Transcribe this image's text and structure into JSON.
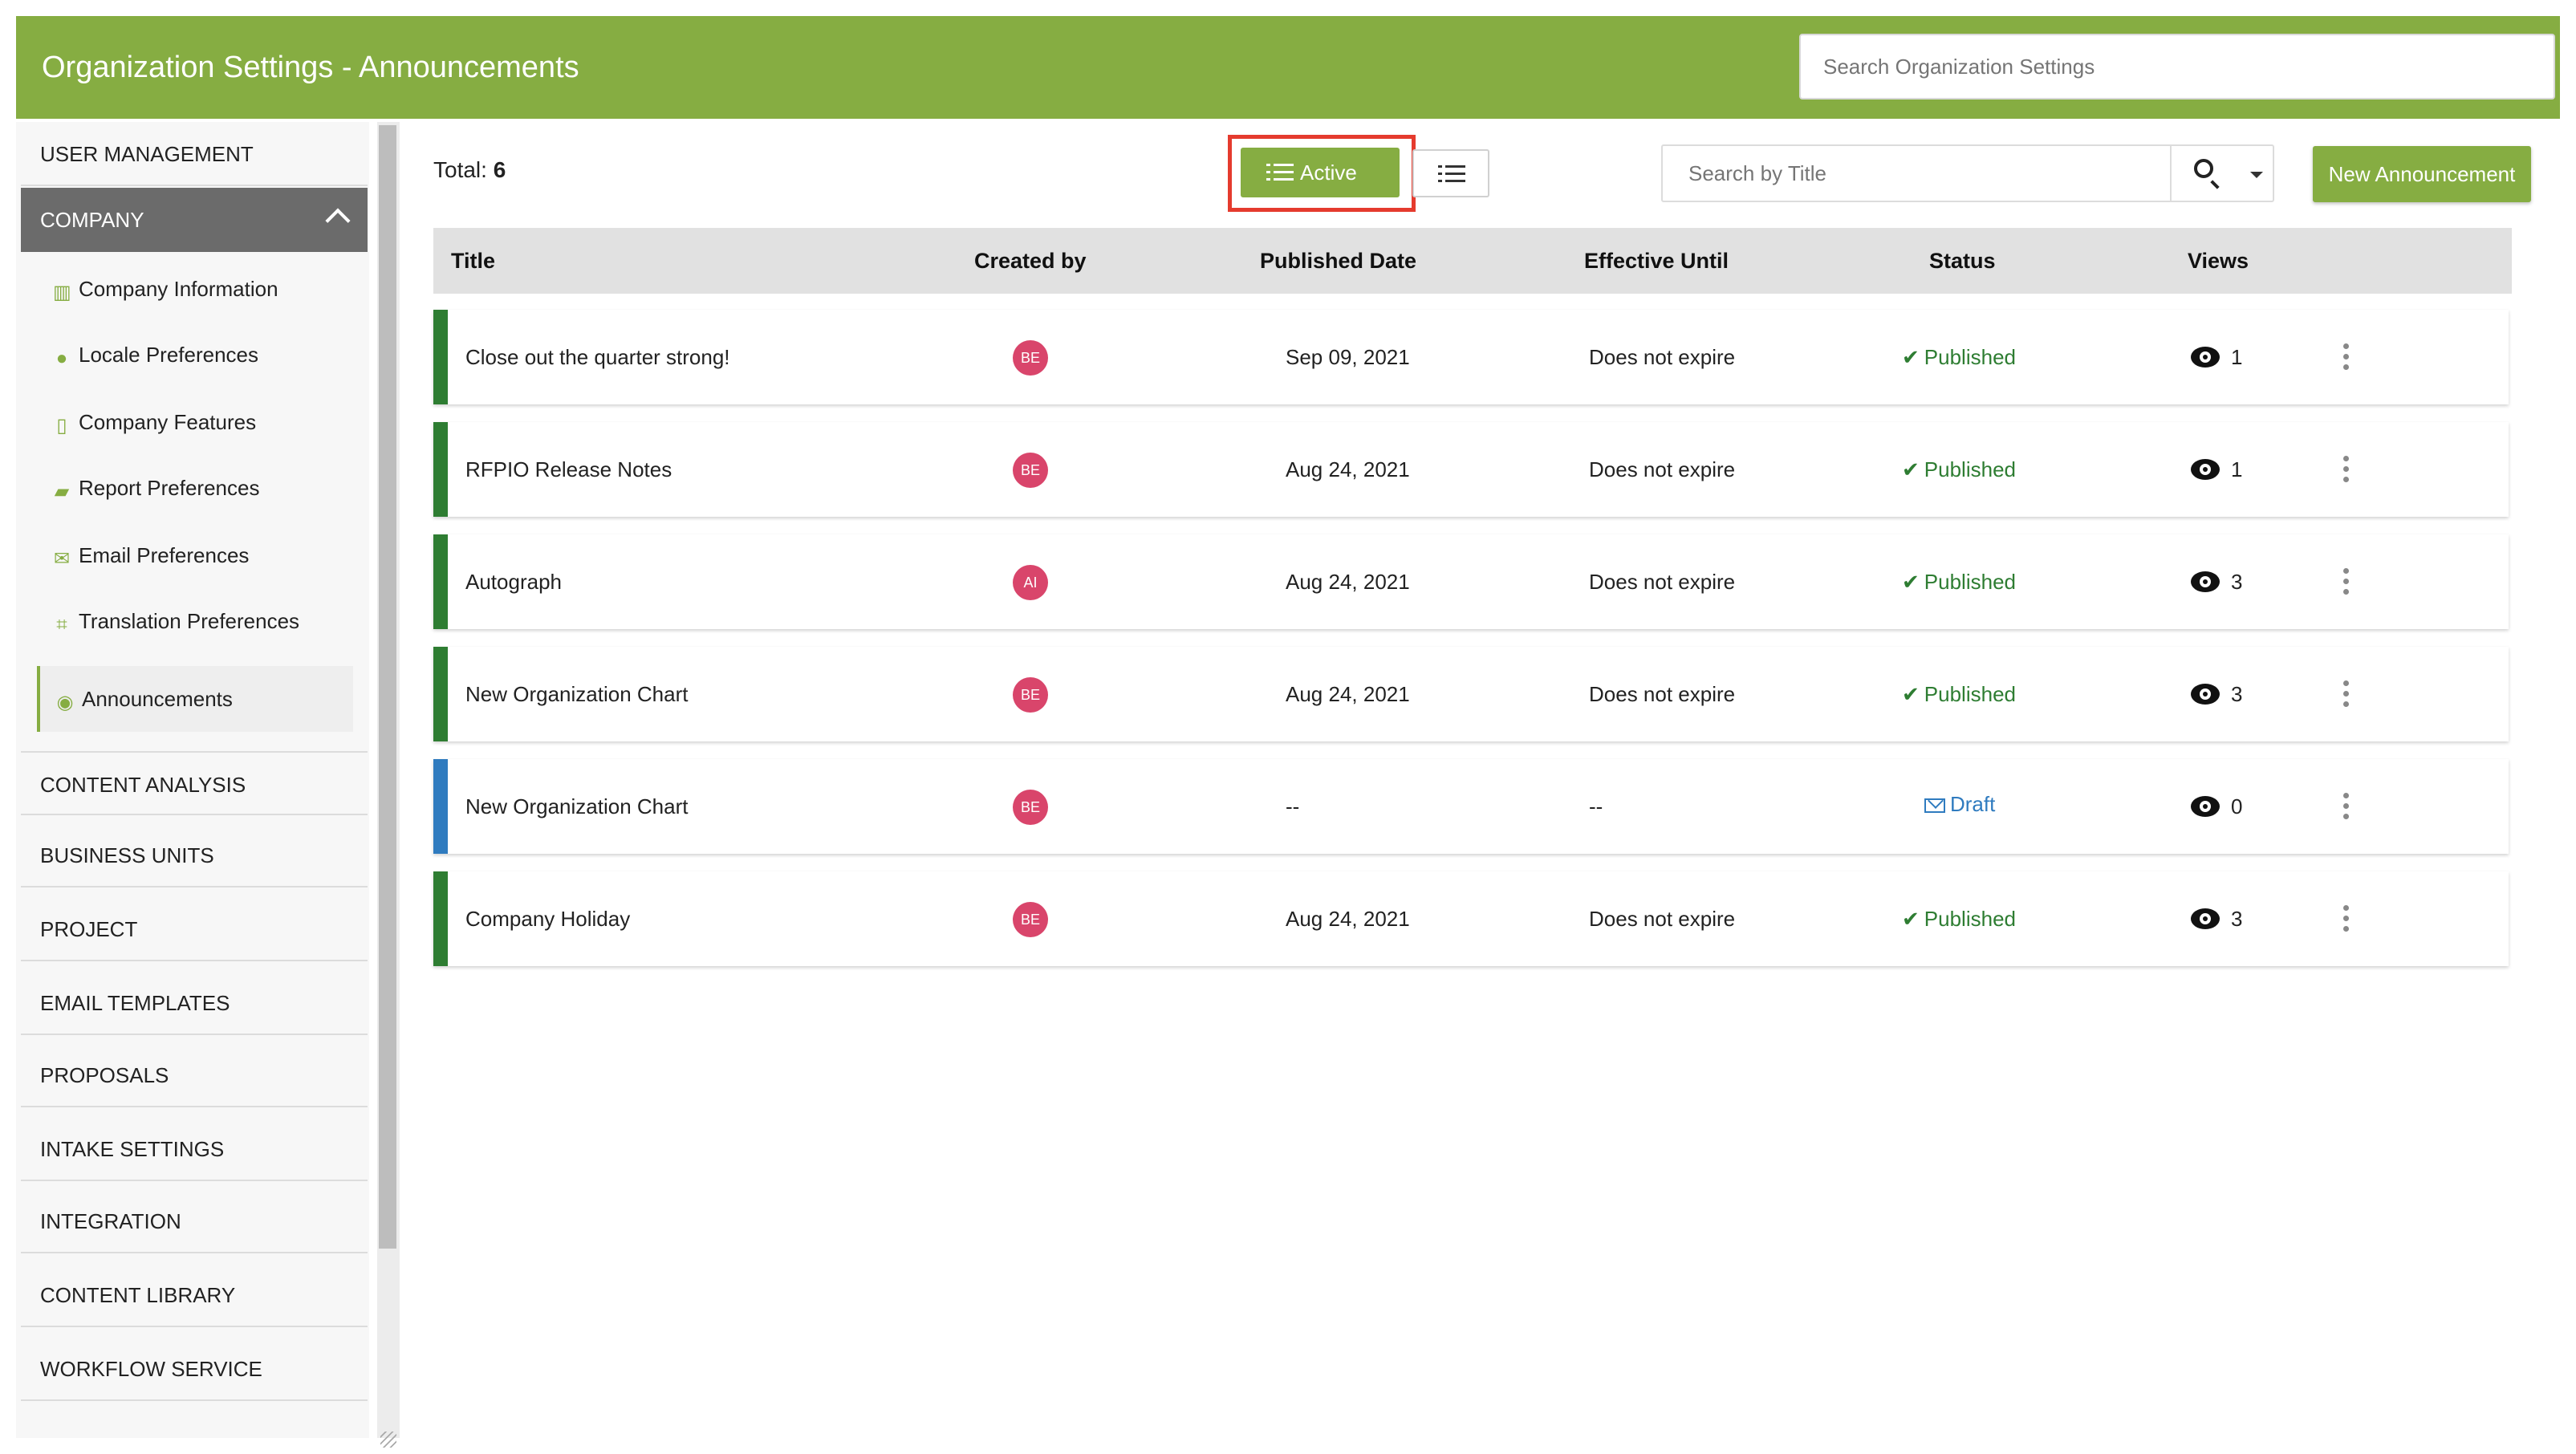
{
  "header": {
    "title": "Organization Settings - Announcements",
    "search_placeholder": "Search Organization Settings"
  },
  "sidebar": {
    "sections": [
      {
        "label": "USER MANAGEMENT"
      },
      {
        "label": "COMPANY",
        "expanded": true
      },
      {
        "label": "CONTENT ANALYSIS"
      },
      {
        "label": "BUSINESS UNITS"
      },
      {
        "label": "PROJECT"
      },
      {
        "label": "EMAIL TEMPLATES"
      },
      {
        "label": "PROPOSALS"
      },
      {
        "label": "INTAKE SETTINGS"
      },
      {
        "label": "INTEGRATION"
      },
      {
        "label": "CONTENT LIBRARY"
      },
      {
        "label": "WORKFLOW SERVICE"
      }
    ],
    "company_items": [
      {
        "label": "Company Information",
        "icon": "building-icon"
      },
      {
        "label": "Locale Preferences",
        "icon": "globe-icon"
      },
      {
        "label": "Company Features",
        "icon": "bookmark-icon"
      },
      {
        "label": "Report Preferences",
        "icon": "book-icon"
      },
      {
        "label": "Email Preferences",
        "icon": "envelope-icon"
      },
      {
        "label": "Translation Preferences",
        "icon": "translate-icon"
      },
      {
        "label": "Announcements",
        "icon": "broadcast-icon",
        "selected": true
      }
    ]
  },
  "toolbar": {
    "total_label": "Total:",
    "total_value": "6",
    "active_label": "Active",
    "title_search_placeholder": "Search by Title",
    "new_button_label": "New Announcement"
  },
  "table": {
    "headers": [
      "Title",
      "Created by",
      "Published Date",
      "Effective Until",
      "Status",
      "Views"
    ],
    "rows": [
      {
        "title": "Close out the quarter strong!",
        "created_by": "BE",
        "published": "Sep 09, 2021",
        "effective": "Does not expire",
        "status": "Published",
        "views": "1",
        "bar_color": "#2e7d32"
      },
      {
        "title": "RFPIO Release Notes",
        "created_by": "BE",
        "published": "Aug 24, 2021",
        "effective": "Does not expire",
        "status": "Published",
        "views": "1",
        "bar_color": "#2e7d32"
      },
      {
        "title": "Autograph",
        "created_by": "AI",
        "published": "Aug 24, 2021",
        "effective": "Does not expire",
        "status": "Published",
        "views": "3",
        "bar_color": "#2e7d32"
      },
      {
        "title": "New Organization Chart",
        "created_by": "BE",
        "published": "Aug 24, 2021",
        "effective": "Does not expire",
        "status": "Published",
        "views": "3",
        "bar_color": "#2e7d32"
      },
      {
        "title": "New Organization Chart",
        "created_by": "BE",
        "published": "--",
        "effective": "--",
        "status": "Draft",
        "views": "0",
        "bar_color": "#2f7bbf"
      },
      {
        "title": "Company Holiday",
        "created_by": "BE",
        "published": "Aug 24, 2021",
        "effective": "Does not expire",
        "status": "Published",
        "views": "3",
        "bar_color": "#2e7d32"
      }
    ]
  },
  "colors": {
    "brand_green": "#86ad42",
    "published_green": "#2e7d32",
    "draft_blue": "#2f7bbf",
    "avatar_pink": "#d9456b",
    "highlight_red": "#e53b2e"
  }
}
